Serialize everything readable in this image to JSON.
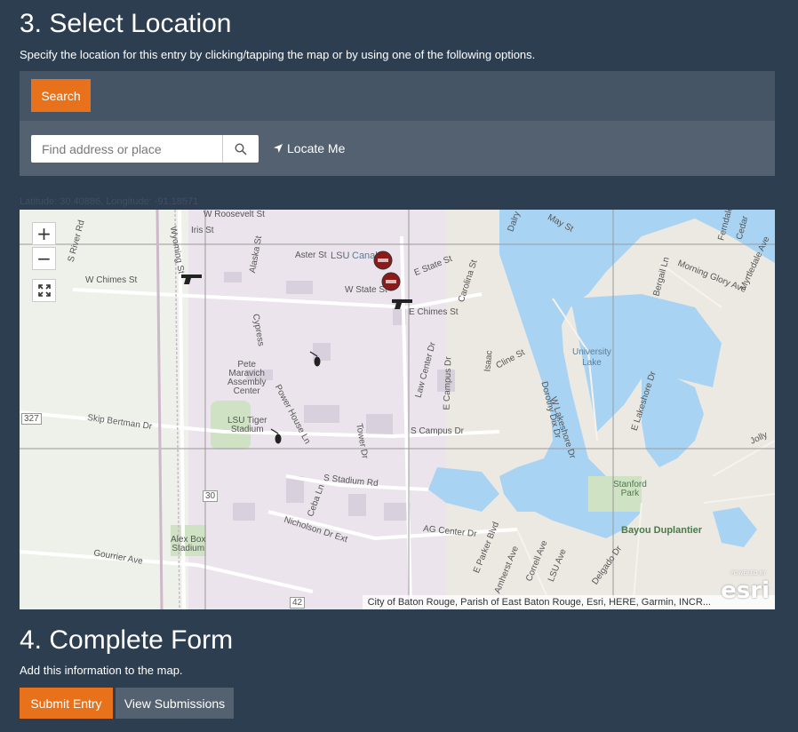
{
  "section3": {
    "title": "3. Select Location",
    "description": "Specify the location for this entry by clicking/tapping the map or by using one of the following options."
  },
  "search_tab": {
    "label": "Search"
  },
  "search": {
    "placeholder": "Find address or place",
    "locate_label": "Locate Me"
  },
  "coordinates": "Latitude: 30.40886, Longitude: -91.18571",
  "map": {
    "zoom_in": "+",
    "zoom_out": "−",
    "attribution": "City of Baton Rouge, Parish of East Baton Rouge, Esri, HERE, Garmin, INCR...",
    "esri_powered": "POWERED BY",
    "esri_logo": "esri",
    "labels": {
      "w_roosevelt": "W Roosevelt St",
      "iris": "Iris St",
      "aster": "Aster St",
      "lsu": "LSU",
      "canal": "Canal",
      "w_chimes": "W Chimes St",
      "w_state": "W State St",
      "e_state": "E State St",
      "e_chimes": "E Chimes St",
      "carolina": "Carolina St",
      "may": "May St",
      "dalry": "Dalry",
      "s_river": "S River Rd",
      "wyoming": "Wyoming St",
      "alaska": "Alaska St",
      "cypress": "Cypress",
      "pete": "Pete\nMaravich\nAssembly\nCenter",
      "tiger": "LSU Tiger\nStadium",
      "power": "Power House Ln",
      "tower": "Tower Dr",
      "law": "Law Center Dr",
      "e_campus": "E Campus Dr",
      "s_campus": "S Campus Dr",
      "s_stadium": "S Stadium Rd",
      "skip": "Skip Bertman Dr",
      "ceba": "Ceba Ln",
      "nicholson": "Nicholson Dr Ext",
      "ag": "AG Center Dr",
      "alex": "Alex Box\nStadium",
      "gourrier": "Gourrier Ave",
      "univ_lake": "University\nLake",
      "w_lakeshore": "W Lakeshore Dr",
      "e_lakeshore": "E Lakeshore Dr",
      "dorothy": "Dorothy Dix Dr",
      "cline": "Cline St",
      "isaac": "Isaac",
      "stanford": "Stanford\nPark",
      "bayou": "Bayou Duplantier",
      "bergail": "Bergail Ln",
      "morning": "Morning Glory Ave",
      "myrtledale": "Myrtledale Ave",
      "e_parker": "E Parker Blvd",
      "amherst": "Amherst Ave",
      "correll": "Correll Ave",
      "lsu_ave": "LSU Ave",
      "delgado": "Delgado Dr",
      "jolly": "Jolly",
      "ferndale": "Ferndale",
      "cedar": "Cedar",
      "rt327": "327",
      "rt30": "30",
      "rt42": "42"
    }
  },
  "section4": {
    "title": "4. Complete Form",
    "description": "Add this information to the map."
  },
  "buttons": {
    "submit": "Submit Entry",
    "view": "View Submissions"
  },
  "colors": {
    "accent": "#e8721c",
    "background": "#2c3e50",
    "panel": "#465565",
    "water": "#a9d3f2"
  }
}
